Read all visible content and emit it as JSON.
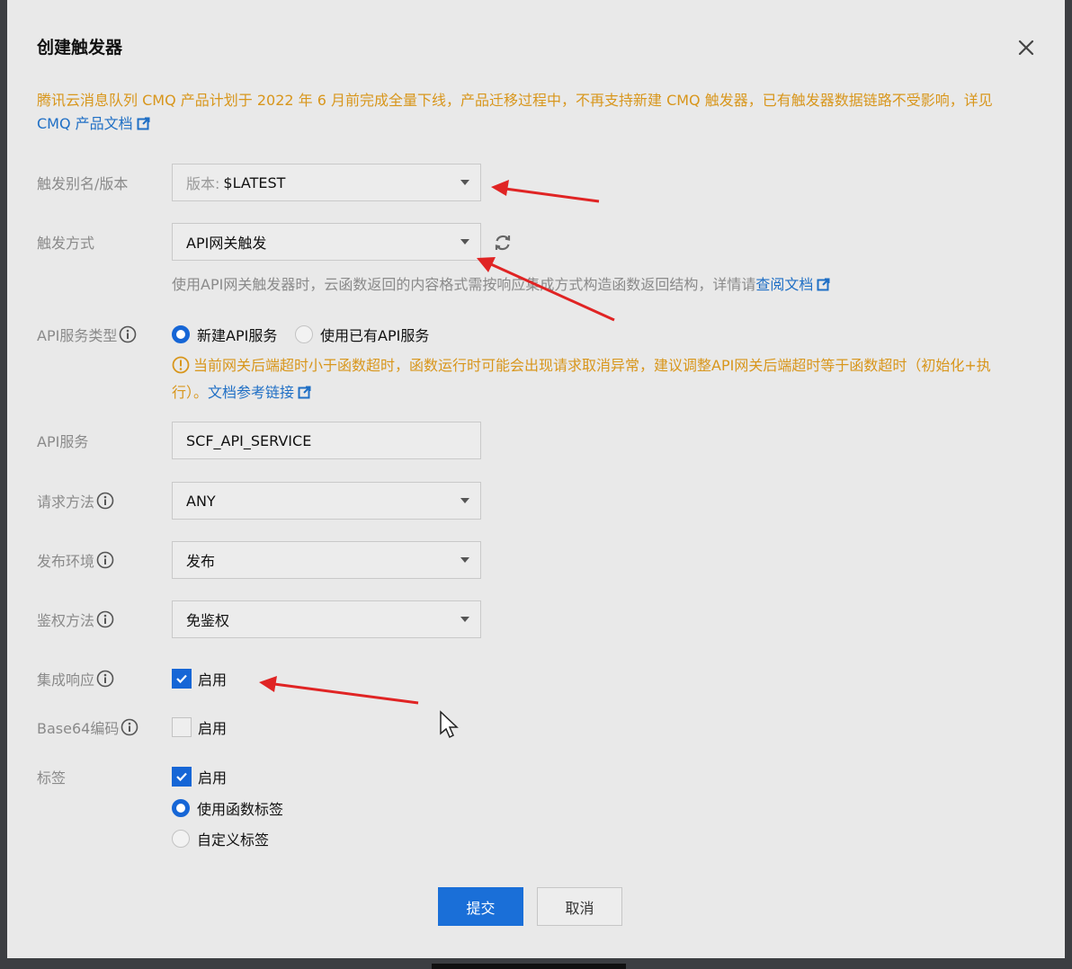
{
  "dialog": {
    "title": "创建触发器"
  },
  "notice": {
    "text": "腾讯云消息队列 CMQ 产品计划于 2022 年 6 月前完成全量下线，产品迁移过程中，不再支持新建 CMQ 触发器，已有触发器数据链路不受影响，详见",
    "link": "CMQ 产品文档"
  },
  "fields": {
    "alias": {
      "label": "触发别名/版本",
      "prefix": "版本:",
      "value": "$LATEST"
    },
    "trigger_type": {
      "label": "触发方式",
      "value": "API网关触发",
      "hint": "使用API网关触发器时，云函数返回的内容格式需按响应集成方式构造函数返回结构，详情请",
      "hint_link": "查阅文档"
    },
    "api_service_type": {
      "label": "API服务类型",
      "option_new": "新建API服务",
      "option_existing": "使用已有API服务",
      "warning": "当前网关后端超时小于函数超时，函数运行时可能会出现请求取消异常，建议调整API网关后端超时等于函数超时（初始化+执行）。",
      "warning_link": "文档参考链接"
    },
    "api_service": {
      "label": "API服务",
      "value": "SCF_API_SERVICE"
    },
    "method": {
      "label": "请求方法",
      "value": "ANY"
    },
    "env": {
      "label": "发布环境",
      "value": "发布"
    },
    "auth": {
      "label": "鉴权方法",
      "value": "免鉴权"
    },
    "integration": {
      "label": "集成响应",
      "option": "启用",
      "checked": true
    },
    "base64": {
      "label": "Base64编码",
      "option": "启用",
      "checked": false
    },
    "tags": {
      "label": "标签",
      "option": "启用",
      "checked": true,
      "radio_function": "使用函数标签",
      "radio_custom": "自定义标签"
    }
  },
  "buttons": {
    "submit": "提交",
    "cancel": "取消"
  },
  "colors": {
    "primary": "#1a6fd8",
    "warning": "#d8961c",
    "link": "#1f6fc5",
    "annotation": "#e02424"
  }
}
